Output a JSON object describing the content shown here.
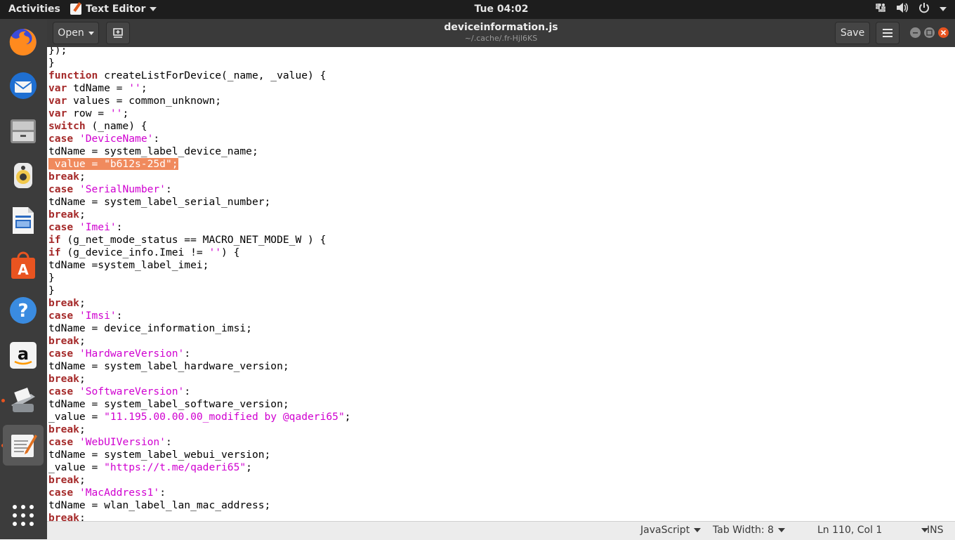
{
  "topbar": {
    "activities": "Activities",
    "app_name": "Text Editor",
    "clock": "Tue 04:02"
  },
  "dock": {
    "items": [
      {
        "name": "firefox",
        "color": "#e66000"
      },
      {
        "name": "thunderbird",
        "color": "#2a6fb8"
      },
      {
        "name": "files",
        "color": "#7a7a7a"
      },
      {
        "name": "rhythmbox",
        "color": "#f2c94c"
      },
      {
        "name": "libreoffice-writer",
        "color": "#2a6ac1"
      },
      {
        "name": "ubuntu-software",
        "color": "#e95420"
      },
      {
        "name": "help",
        "color": "#3a8be0"
      },
      {
        "name": "amazon",
        "color": "#ffffff"
      },
      {
        "name": "scanner",
        "color": "#9aa0a6"
      },
      {
        "name": "text-editor",
        "color": "#f4f4f4"
      }
    ]
  },
  "header": {
    "open_label": "Open",
    "title": "deviceinformation.js",
    "subtitle": "~/.cache/.fr-Hjl6KS",
    "save_label": "Save"
  },
  "editor": {
    "selected_line_index": 9,
    "lines": [
      "});",
      "}",
      "function createListForDevice(_name, _value) {",
      "var tdName = '';",
      "var values = common_unknown;",
      "var row = '';",
      "switch (_name) {",
      "case 'DeviceName':",
      "tdName = system_label_device_name;",
      "_value = \"b612s-25d\";",
      "break;",
      "case 'SerialNumber':",
      "tdName = system_label_serial_number;",
      "break;",
      "case 'Imei':",
      "if (g_net_mode_status == MACRO_NET_MODE_W ) {",
      "if (g_device_info.Imei != '') {",
      "tdName =system_label_imei;",
      "}",
      "}",
      "break;",
      "case 'Imsi':",
      "tdName = device_information_imsi;",
      "break;",
      "case 'HardwareVersion':",
      "tdName = system_label_hardware_version;",
      "break;",
      "case 'SoftwareVersion':",
      "tdName = system_label_software_version;",
      "_value = \"11.195.00.00.00_modified by @qaderi65\";",
      "break;",
      "case 'WebUIVersion':",
      "tdName = system_label_webui_version;",
      "_value = \"https://t.me/qaderi65\";",
      "break;",
      "case 'MacAddress1':",
      "tdName = wlan_label_lan_mac_address;",
      "break;"
    ]
  },
  "status": {
    "language": "JavaScript",
    "tab_width": "Tab Width: 8",
    "position": "Ln 110, Col 1",
    "mode": "INS"
  }
}
